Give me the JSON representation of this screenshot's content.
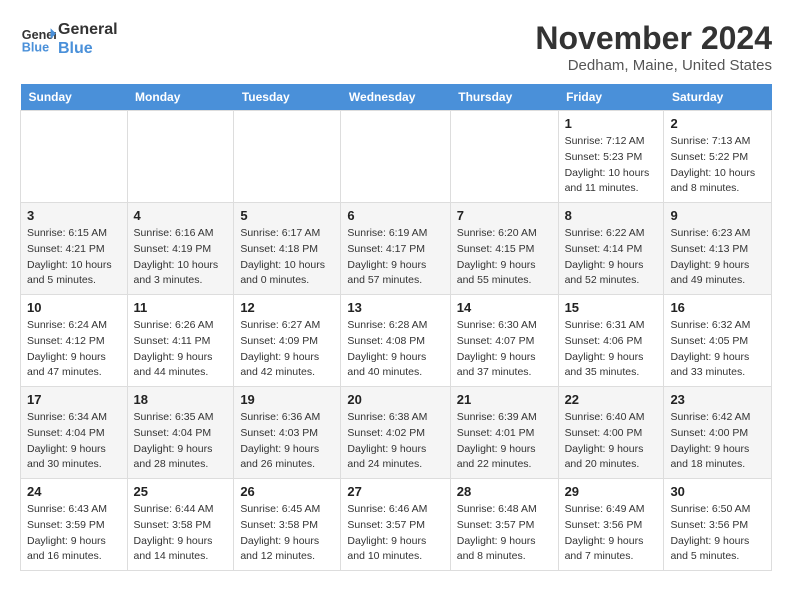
{
  "header": {
    "logo_line1": "General",
    "logo_line2": "Blue",
    "month": "November 2024",
    "location": "Dedham, Maine, United States"
  },
  "weekdays": [
    "Sunday",
    "Monday",
    "Tuesday",
    "Wednesday",
    "Thursday",
    "Friday",
    "Saturday"
  ],
  "weeks": [
    [
      {
        "day": "",
        "info": ""
      },
      {
        "day": "",
        "info": ""
      },
      {
        "day": "",
        "info": ""
      },
      {
        "day": "",
        "info": ""
      },
      {
        "day": "",
        "info": ""
      },
      {
        "day": "1",
        "info": "Sunrise: 7:12 AM\nSunset: 5:23 PM\nDaylight: 10 hours\nand 11 minutes."
      },
      {
        "day": "2",
        "info": "Sunrise: 7:13 AM\nSunset: 5:22 PM\nDaylight: 10 hours\nand 8 minutes."
      }
    ],
    [
      {
        "day": "3",
        "info": "Sunrise: 6:15 AM\nSunset: 4:21 PM\nDaylight: 10 hours\nand 5 minutes."
      },
      {
        "day": "4",
        "info": "Sunrise: 6:16 AM\nSunset: 4:19 PM\nDaylight: 10 hours\nand 3 minutes."
      },
      {
        "day": "5",
        "info": "Sunrise: 6:17 AM\nSunset: 4:18 PM\nDaylight: 10 hours\nand 0 minutes."
      },
      {
        "day": "6",
        "info": "Sunrise: 6:19 AM\nSunset: 4:17 PM\nDaylight: 9 hours\nand 57 minutes."
      },
      {
        "day": "7",
        "info": "Sunrise: 6:20 AM\nSunset: 4:15 PM\nDaylight: 9 hours\nand 55 minutes."
      },
      {
        "day": "8",
        "info": "Sunrise: 6:22 AM\nSunset: 4:14 PM\nDaylight: 9 hours\nand 52 minutes."
      },
      {
        "day": "9",
        "info": "Sunrise: 6:23 AM\nSunset: 4:13 PM\nDaylight: 9 hours\nand 49 minutes."
      }
    ],
    [
      {
        "day": "10",
        "info": "Sunrise: 6:24 AM\nSunset: 4:12 PM\nDaylight: 9 hours\nand 47 minutes."
      },
      {
        "day": "11",
        "info": "Sunrise: 6:26 AM\nSunset: 4:11 PM\nDaylight: 9 hours\nand 44 minutes."
      },
      {
        "day": "12",
        "info": "Sunrise: 6:27 AM\nSunset: 4:09 PM\nDaylight: 9 hours\nand 42 minutes."
      },
      {
        "day": "13",
        "info": "Sunrise: 6:28 AM\nSunset: 4:08 PM\nDaylight: 9 hours\nand 40 minutes."
      },
      {
        "day": "14",
        "info": "Sunrise: 6:30 AM\nSunset: 4:07 PM\nDaylight: 9 hours\nand 37 minutes."
      },
      {
        "day": "15",
        "info": "Sunrise: 6:31 AM\nSunset: 4:06 PM\nDaylight: 9 hours\nand 35 minutes."
      },
      {
        "day": "16",
        "info": "Sunrise: 6:32 AM\nSunset: 4:05 PM\nDaylight: 9 hours\nand 33 minutes."
      }
    ],
    [
      {
        "day": "17",
        "info": "Sunrise: 6:34 AM\nSunset: 4:04 PM\nDaylight: 9 hours\nand 30 minutes."
      },
      {
        "day": "18",
        "info": "Sunrise: 6:35 AM\nSunset: 4:04 PM\nDaylight: 9 hours\nand 28 minutes."
      },
      {
        "day": "19",
        "info": "Sunrise: 6:36 AM\nSunset: 4:03 PM\nDaylight: 9 hours\nand 26 minutes."
      },
      {
        "day": "20",
        "info": "Sunrise: 6:38 AM\nSunset: 4:02 PM\nDaylight: 9 hours\nand 24 minutes."
      },
      {
        "day": "21",
        "info": "Sunrise: 6:39 AM\nSunset: 4:01 PM\nDaylight: 9 hours\nand 22 minutes."
      },
      {
        "day": "22",
        "info": "Sunrise: 6:40 AM\nSunset: 4:00 PM\nDaylight: 9 hours\nand 20 minutes."
      },
      {
        "day": "23",
        "info": "Sunrise: 6:42 AM\nSunset: 4:00 PM\nDaylight: 9 hours\nand 18 minutes."
      }
    ],
    [
      {
        "day": "24",
        "info": "Sunrise: 6:43 AM\nSunset: 3:59 PM\nDaylight: 9 hours\nand 16 minutes."
      },
      {
        "day": "25",
        "info": "Sunrise: 6:44 AM\nSunset: 3:58 PM\nDaylight: 9 hours\nand 14 minutes."
      },
      {
        "day": "26",
        "info": "Sunrise: 6:45 AM\nSunset: 3:58 PM\nDaylight: 9 hours\nand 12 minutes."
      },
      {
        "day": "27",
        "info": "Sunrise: 6:46 AM\nSunset: 3:57 PM\nDaylight: 9 hours\nand 10 minutes."
      },
      {
        "day": "28",
        "info": "Sunrise: 6:48 AM\nSunset: 3:57 PM\nDaylight: 9 hours\nand 8 minutes."
      },
      {
        "day": "29",
        "info": "Sunrise: 6:49 AM\nSunset: 3:56 PM\nDaylight: 9 hours\nand 7 minutes."
      },
      {
        "day": "30",
        "info": "Sunrise: 6:50 AM\nSunset: 3:56 PM\nDaylight: 9 hours\nand 5 minutes."
      }
    ]
  ]
}
